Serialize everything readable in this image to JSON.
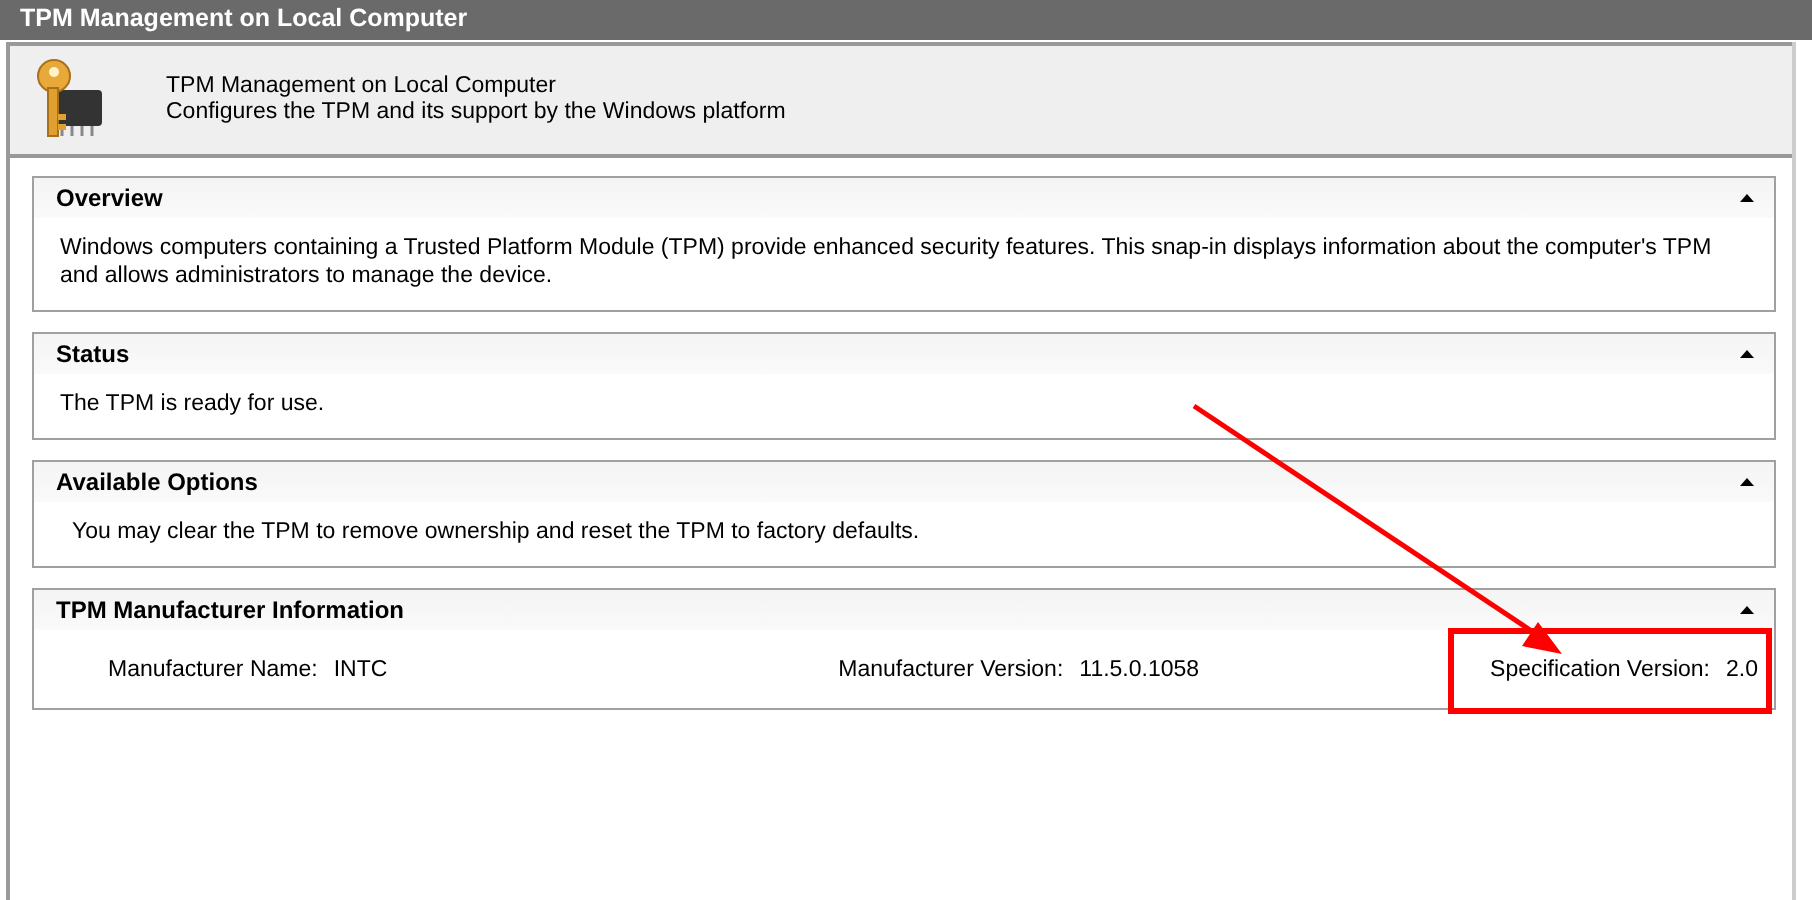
{
  "window": {
    "title": "TPM Management on Local Computer"
  },
  "header": {
    "title": "TPM Management on Local Computer",
    "subtitle": "Configures the TPM and its support by the Windows platform"
  },
  "sections": [
    {
      "title": "Overview",
      "expanded": true,
      "kind": "text",
      "text": "Windows computers containing a Trusted Platform Module (TPM) provide enhanced security features. This snap-in displays information about the computer's TPM and allows administrators to manage the device."
    },
    {
      "title": "Status",
      "expanded": true,
      "kind": "text",
      "text": "The TPM is ready for use."
    },
    {
      "title": "Available Options",
      "expanded": true,
      "kind": "option",
      "text": "You may clear the TPM to remove ownership and reset the TPM to factory defaults."
    },
    {
      "title": "TPM Manufacturer Information",
      "expanded": true,
      "kind": "fields",
      "fields": [
        {
          "label": "Manufacturer Name:",
          "value": "INTC",
          "highlighted": false
        },
        {
          "label": "Manufacturer Version:",
          "value": "11.5.0.1058",
          "highlighted": false
        },
        {
          "label": "Specification Version:",
          "value": "2.0",
          "highlighted": true
        }
      ]
    }
  ]
}
